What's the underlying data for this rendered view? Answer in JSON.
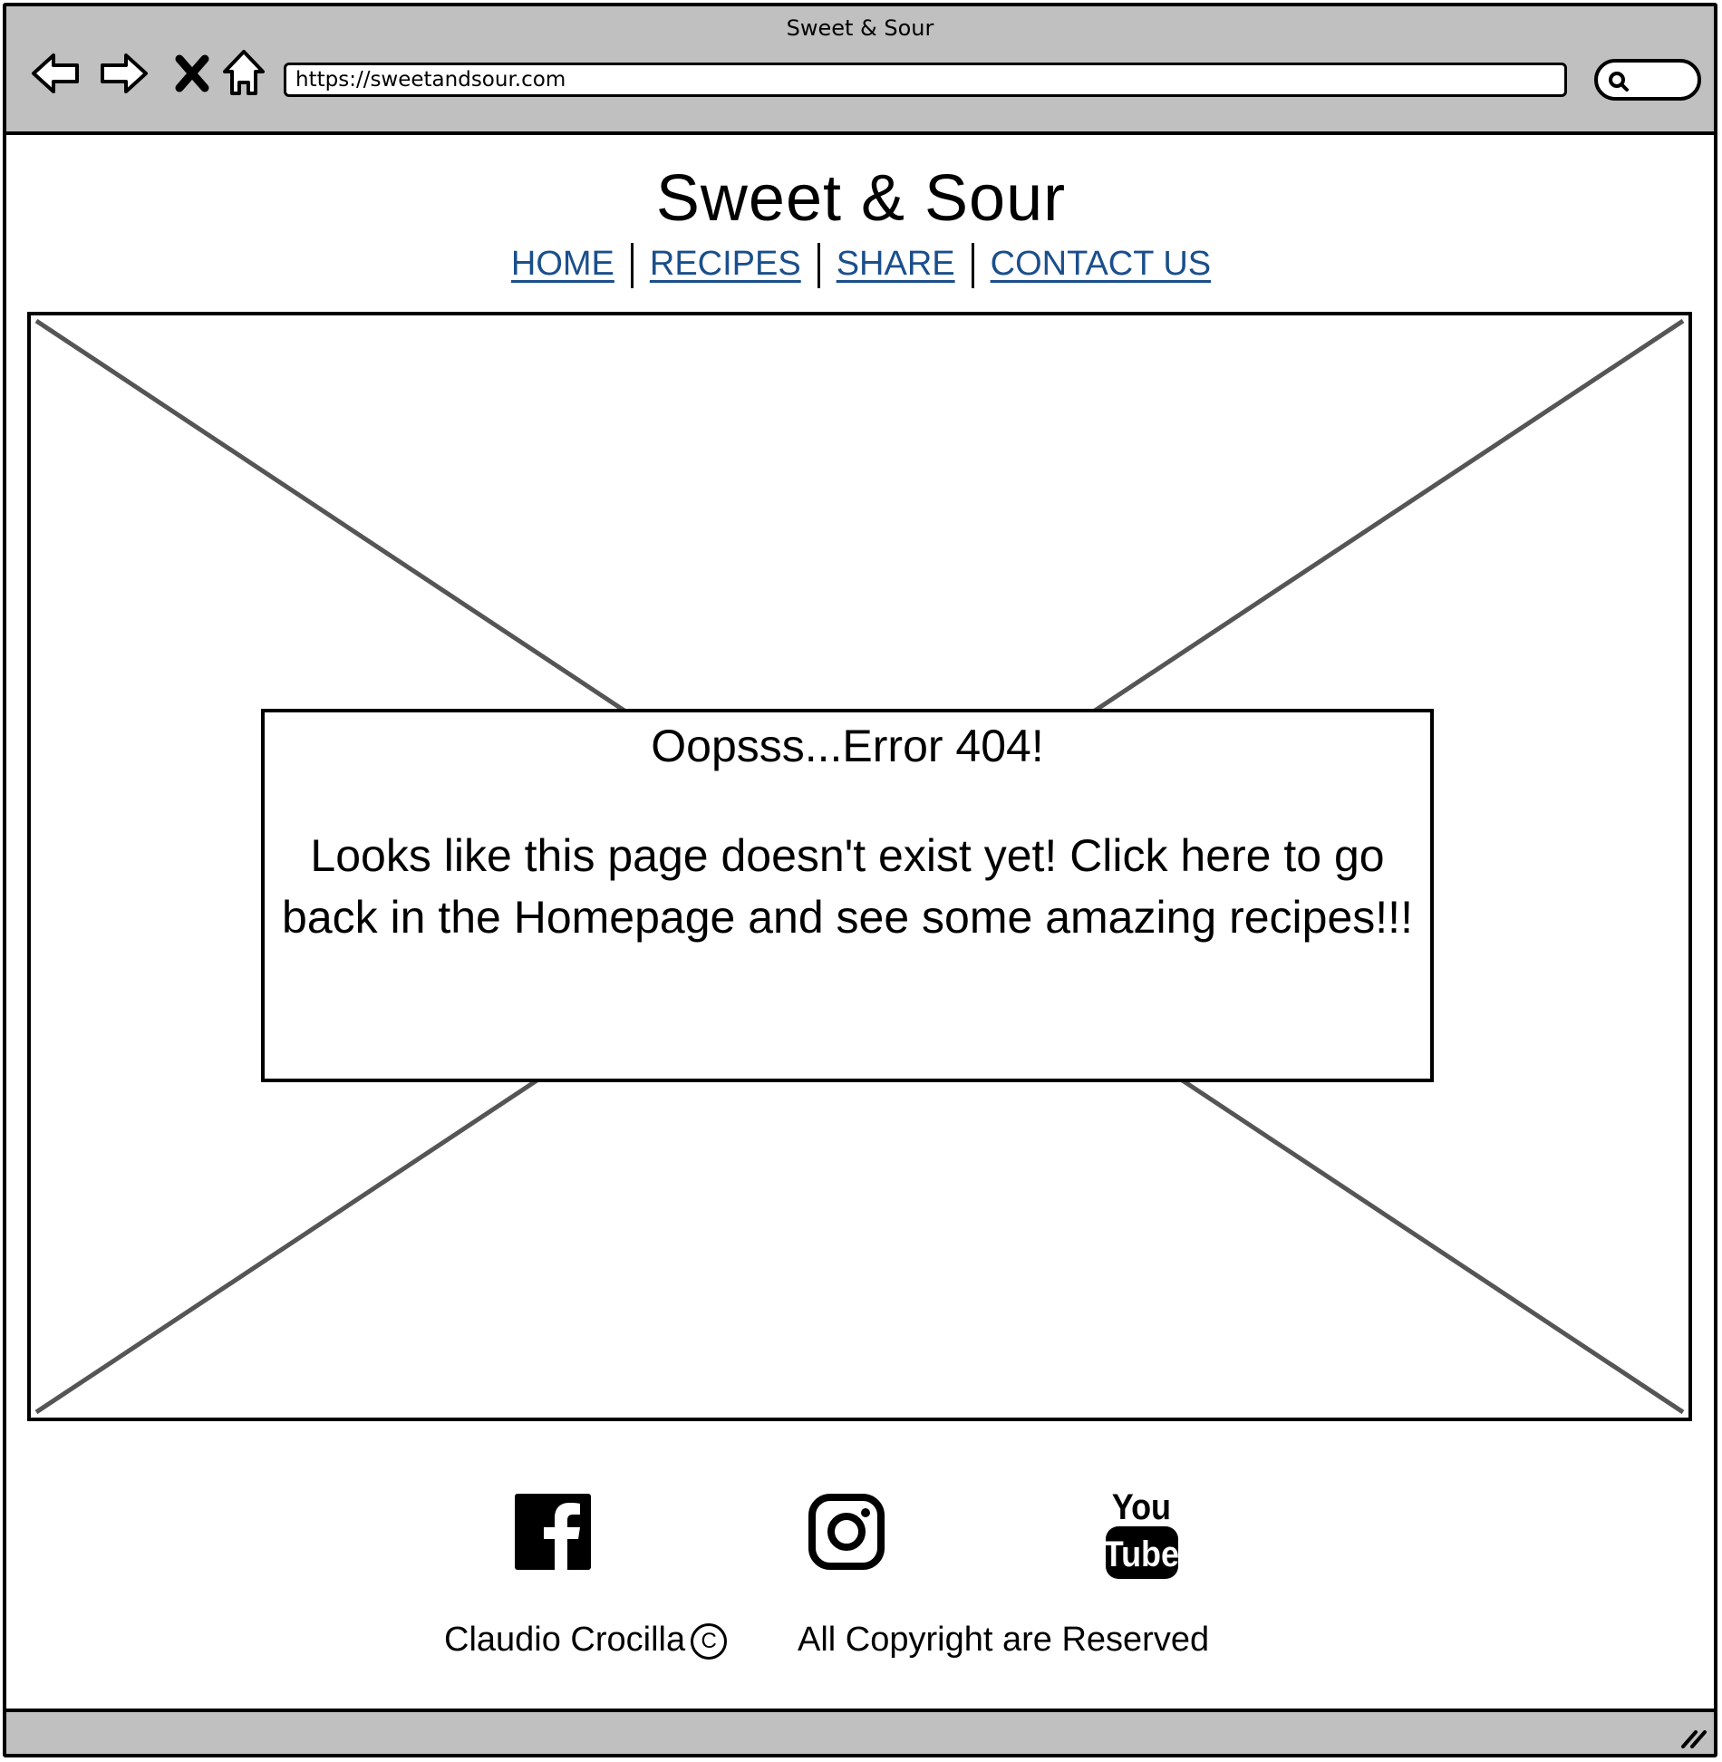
{
  "browser": {
    "window_title": "Sweet & Sour",
    "url": "https://sweetandsour.com",
    "icons": [
      "back-arrow-icon",
      "forward-arrow-icon",
      "stop-x-icon",
      "home-icon",
      "search-icon"
    ]
  },
  "site": {
    "title": "Sweet & Sour",
    "nav": [
      {
        "label": "HOME"
      },
      {
        "label": "RECIPES"
      },
      {
        "label": "SHARE"
      },
      {
        "label": "CONTACT US"
      }
    ]
  },
  "error": {
    "title": "Oopsss...Error 404!",
    "message": "Looks like this page doesn't exist yet! Click here to go back in the Homepage and see some amazing recipes!!!"
  },
  "social": [
    {
      "icon": "facebook-icon"
    },
    {
      "icon": "instagram-icon"
    },
    {
      "icon": "youtube-icon",
      "text_top": "You",
      "text_bottom": "Tube"
    }
  ],
  "footer": {
    "author": "Claudio Crocilla",
    "copyright_symbol": "C",
    "rights": "All Copyright are Reserved"
  },
  "colors": {
    "link": "#1a4f8c",
    "chrome": "#c0c0c0"
  }
}
